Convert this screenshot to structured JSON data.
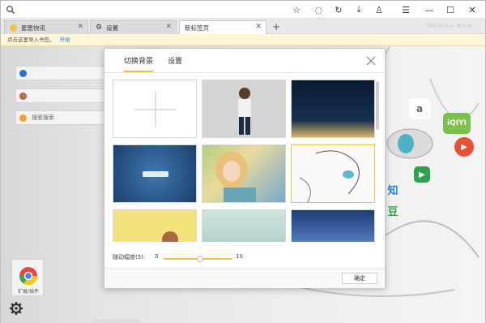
{
  "tabs": [
    {
      "label": "星愿快讯",
      "icon": "star-icon"
    },
    {
      "label": "设置",
      "icon": "gear-icon"
    },
    {
      "label": "新标签页",
      "icon": "",
      "active": true
    }
  ],
  "brand": "Twinkstar Brow",
  "bookmark_bar": {
    "prompt": "点击这里导入书签。",
    "link": "开始"
  },
  "side_items": [
    "",
    "",
    "搜索搜索"
  ],
  "modal": {
    "tabs": [
      "切换背景",
      "设置"
    ],
    "slider": {
      "label": "随动幅度(5):",
      "min": "0",
      "max": "10",
      "value": 5
    },
    "ok_label": "确定"
  },
  "extension_label": "扩展/插件",
  "colors": {
    "accent": "#f0c24a",
    "link": "#2b79d6"
  }
}
